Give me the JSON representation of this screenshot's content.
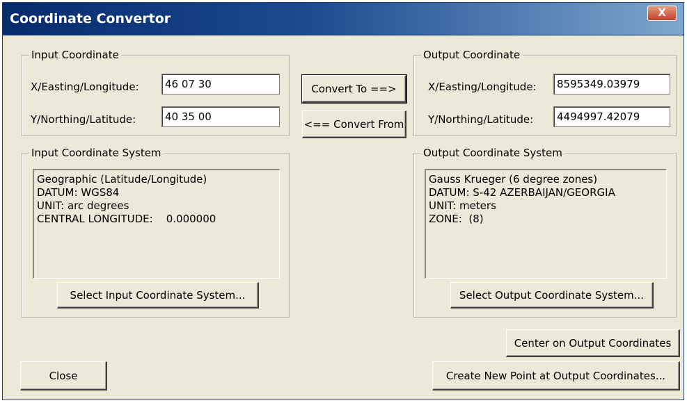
{
  "window": {
    "title": "Coordinate Convertor",
    "close_glyph": "X"
  },
  "input_coordinate": {
    "legend": "Input Coordinate",
    "x_label": "X/Easting/Longitude:",
    "x_value": "46 07 30",
    "y_label": "Y/Northing/Latitude:",
    "y_value": "40 35 00"
  },
  "output_coordinate": {
    "legend": "Output Coordinate",
    "x_label": "X/Easting/Longitude:",
    "x_value": "8595349.03979",
    "y_label": "Y/Northing/Latitude:",
    "y_value": "4494997.42079"
  },
  "buttons": {
    "convert_to": "Convert To ==>",
    "convert_from": "<== Convert From",
    "select_input": "Select Input Coordinate System...",
    "select_output": "Select Output Coordinate System...",
    "center_output": "Center on Output Coordinates",
    "create_point": "Create New Point at Output Coordinates...",
    "close": "Close"
  },
  "input_system": {
    "legend": "Input Coordinate System",
    "lines": [
      "Geographic (Latitude/Longitude)",
      "DATUM: WGS84",
      "UNIT: arc degrees",
      "CENTRAL LONGITUDE:    0.000000"
    ]
  },
  "output_system": {
    "legend": "Output Coordinate System",
    "lines": [
      "Gauss Krueger (6 degree zones)",
      "DATUM: S-42 AZERBAIJAN/GEORGIA",
      "UNIT: meters",
      "ZONE:  (8)"
    ]
  },
  "colors": {
    "titlebar_start": "#082a6e",
    "titlebar_end": "#7fa6cd",
    "dialog_bg": "#ece9d8"
  }
}
